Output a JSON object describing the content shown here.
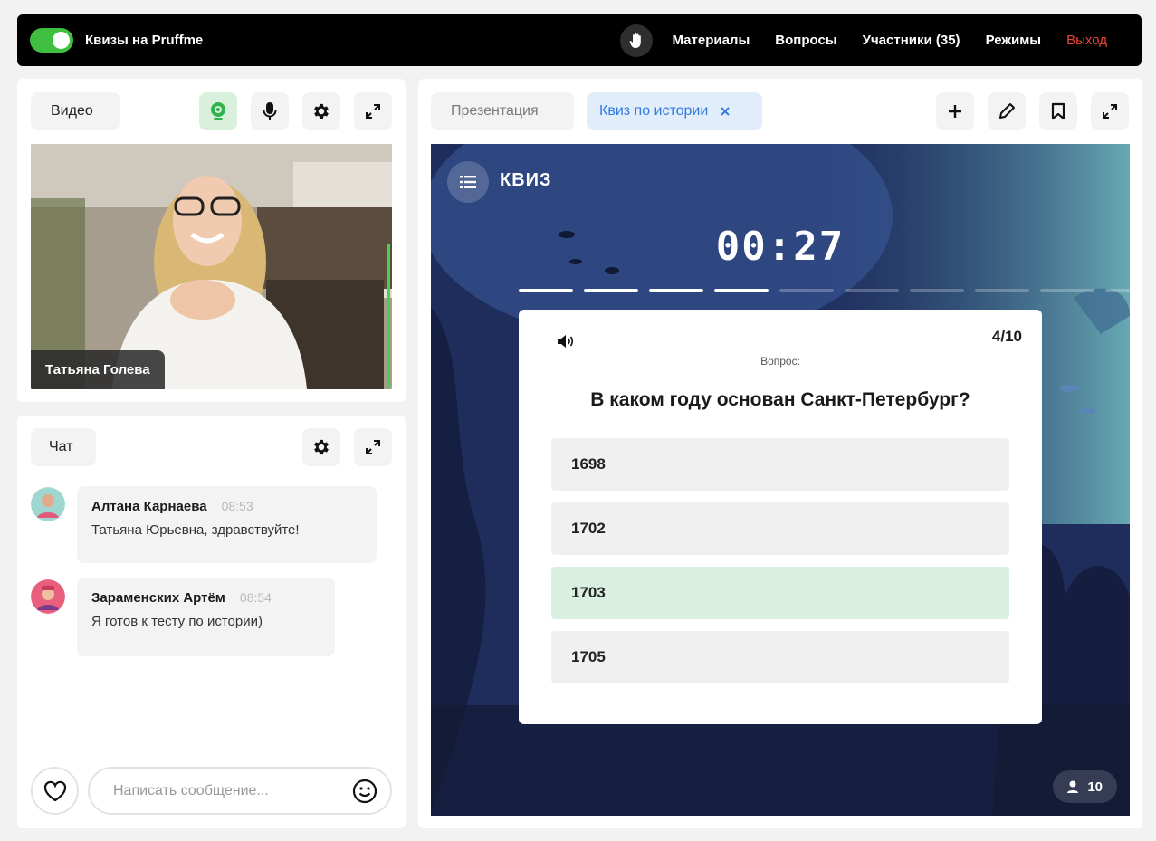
{
  "topbar": {
    "title": "Квизы на Pruffme",
    "nav": [
      "Материалы",
      "Вопросы",
      "Участники (35)",
      "Режимы"
    ],
    "exit": "Выход"
  },
  "video": {
    "tab": "Видео",
    "person_name": "Татьяна Голева"
  },
  "chat": {
    "tab": "Чат",
    "messages": [
      {
        "author": "Алтана Карнаева",
        "time": "08:53",
        "text": "Татьяна Юрьевна, здравствуйте!"
      },
      {
        "author": "Зараменских Артём",
        "time": "08:54",
        "text": "Я готов к тесту по истории)"
      }
    ],
    "input_placeholder": "Написать сообщение..."
  },
  "presentation": {
    "tabs": [
      {
        "label": "Презентация"
      },
      {
        "label": "Квиз по истории"
      }
    ]
  },
  "quiz": {
    "label": "КВИЗ",
    "timer": "00:27",
    "progress": {
      "done": 4,
      "total": 10
    },
    "counter": "4/10",
    "caption": "Вопрос:",
    "question": "В каком году основан Санкт-Петербург?",
    "options": [
      "1698",
      "1702",
      "1703",
      "1705"
    ],
    "correct_index": 2,
    "participants": "10"
  },
  "colors": {
    "accent_green": "#3fbf3f",
    "exit_red": "#e8463a",
    "tab_active_blue": "#2f7be0",
    "correct_bg": "#d8efe1"
  }
}
